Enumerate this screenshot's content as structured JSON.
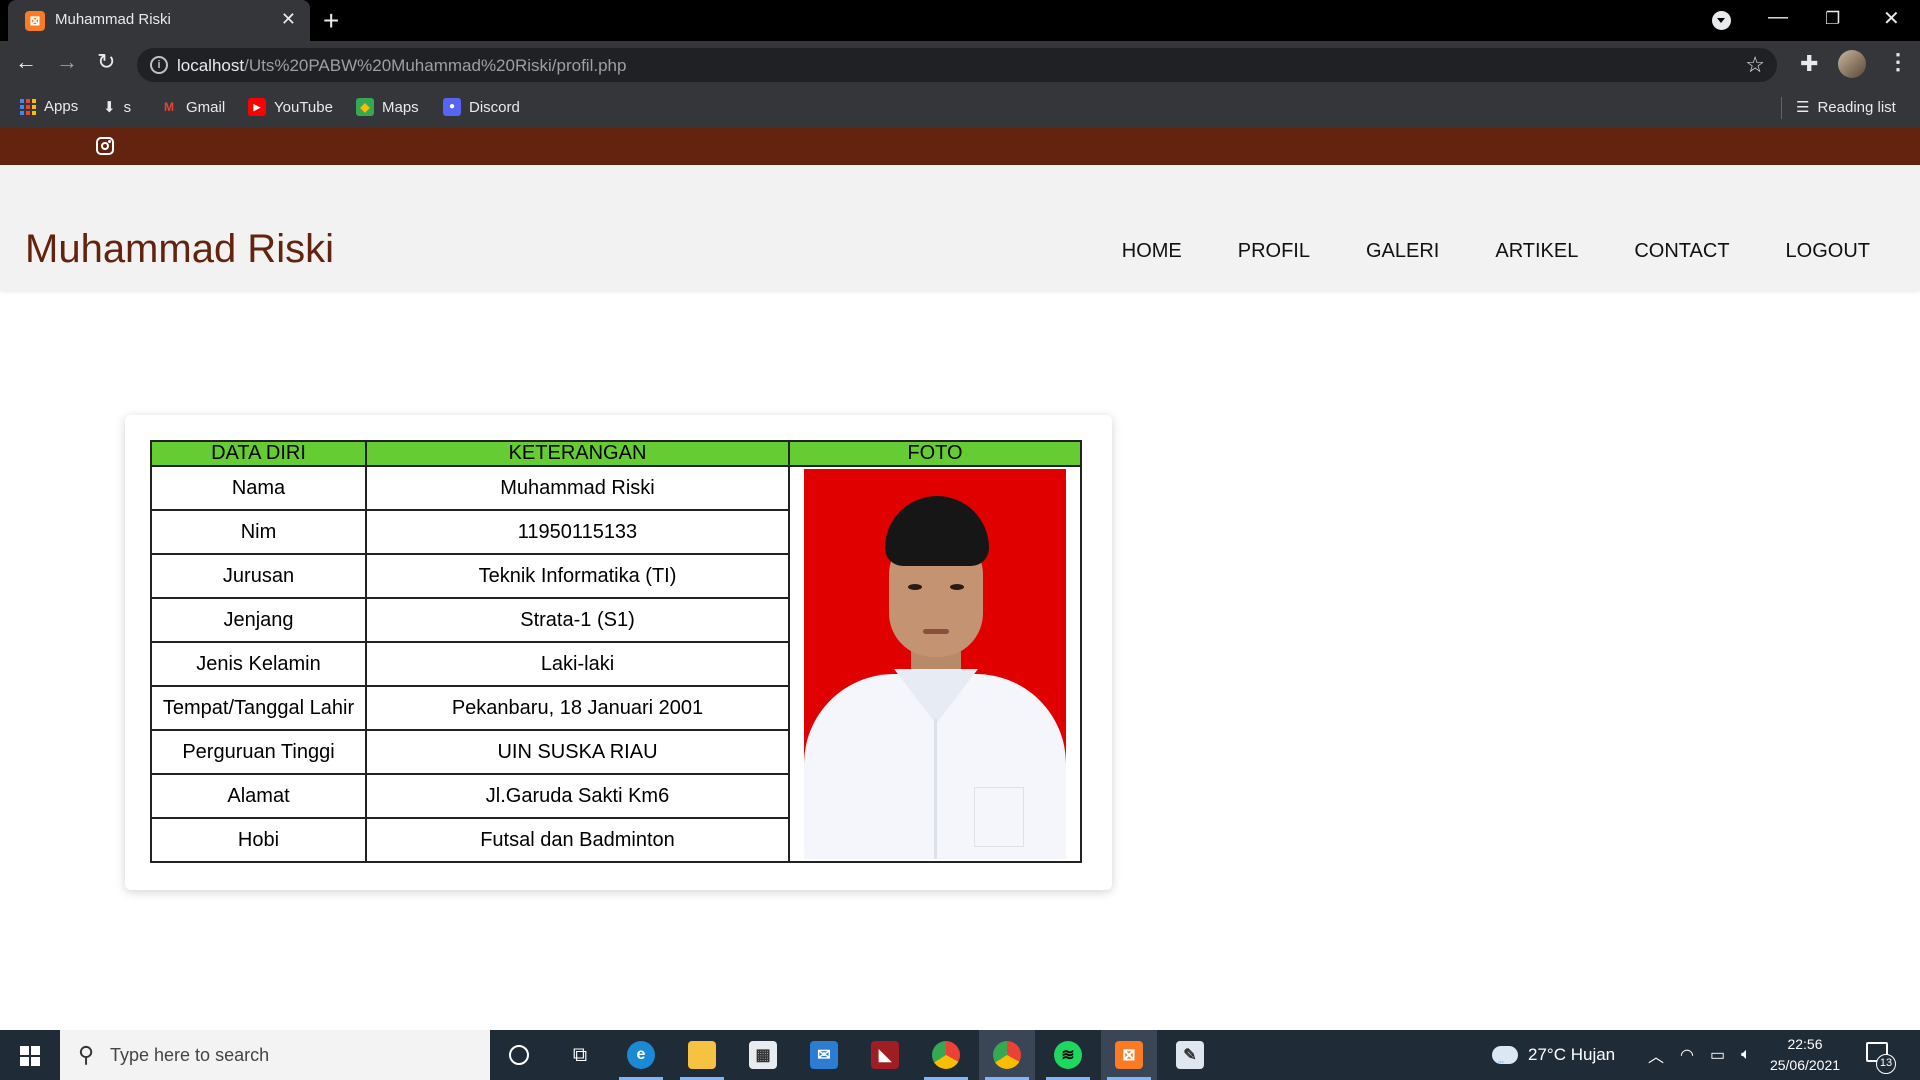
{
  "browser": {
    "tab_title": "Muhammad Riski",
    "tab_favicon": "xampp-icon",
    "url_host": "localhost",
    "url_path": "/Uts%20PABW%20Muhammad%20Riski/profil.php",
    "bookmarks": [
      {
        "label": "Apps",
        "icon": "apps-grid-icon"
      },
      {
        "label": "s",
        "icon": "download-icon"
      },
      {
        "label": "Gmail",
        "icon": "gmail-icon"
      },
      {
        "label": "YouTube",
        "icon": "youtube-icon"
      },
      {
        "label": "Maps",
        "icon": "maps-icon"
      },
      {
        "label": "Discord",
        "icon": "discord-icon"
      }
    ],
    "reading_list": "Reading list"
  },
  "site": {
    "topbar_color": "#63230f",
    "brand": "Muhammad Riski",
    "nav": [
      "HOME",
      "PROFIL",
      "GALERI",
      "ARTIKEL",
      "CONTACT",
      "LOGOUT"
    ]
  },
  "profile_table": {
    "header_color": "#66cc33",
    "headers": [
      "DATA DIRI",
      "KETERANGAN",
      "FOTO"
    ],
    "rows": [
      {
        "label": "Nama",
        "value": "Muhammad Riski"
      },
      {
        "label": "Nim",
        "value": "11950115133"
      },
      {
        "label": "Jurusan",
        "value": "Teknik Informatika (TI)"
      },
      {
        "label": "Jenjang",
        "value": "Strata-1 (S1)"
      },
      {
        "label": "Jenis Kelamin",
        "value": "Laki-laki"
      },
      {
        "label": "Tempat/Tanggal Lahir",
        "value": "Pekanbaru, 18 Januari 2001"
      },
      {
        "label": "Perguruan Tinggi",
        "value": "UIN SUSKA RIAU"
      },
      {
        "label": "Alamat",
        "value": "Jl.Garuda Sakti Km6"
      },
      {
        "label": "Hobi",
        "value": "Futsal dan Badminton"
      }
    ]
  },
  "taskbar": {
    "search_placeholder": "Type here to search",
    "apps": [
      "cortana-icon",
      "task-view-icon",
      "edge-icon",
      "file-explorer-icon",
      "store-icon",
      "mail-icon",
      "game-icon",
      "chrome-icon",
      "chrome-profile-icon",
      "spotify-icon",
      "xampp-icon",
      "paint-icon"
    ],
    "weather": "27°C  Hujan",
    "time": "22:56",
    "date": "25/06/2021",
    "notification_count": "13"
  }
}
